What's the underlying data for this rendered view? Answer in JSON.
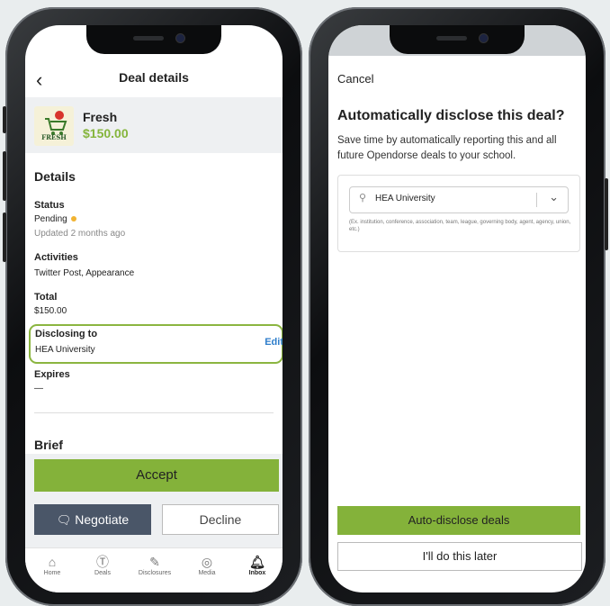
{
  "left": {
    "header": {
      "title": "Deal details",
      "back_icon": "chevron-left-icon"
    },
    "brand": {
      "name": "Fresh",
      "price": "$150.00",
      "logo_text": "FRESH"
    },
    "details": {
      "title": "Details",
      "status_label": "Status",
      "status_value": "Pending",
      "status_updated": "Updated 2 months ago",
      "activities_label": "Activities",
      "activities_value": "Twitter Post, Appearance",
      "total_label": "Total",
      "total_value": "$150.00",
      "disclosing_label": "Disclosing to",
      "disclosing_value": "HEA University",
      "edit_label": "Edit",
      "expires_label": "Expires",
      "expires_value": "—"
    },
    "brief": {
      "title": "Brief"
    },
    "actions": {
      "accept": "Accept",
      "negotiate": "Negotiate",
      "decline": "Decline"
    },
    "tabs": [
      {
        "label": "Home",
        "icon": "home-icon"
      },
      {
        "label": "Deals",
        "icon": "deals-icon"
      },
      {
        "label": "Disclosures",
        "icon": "disclosures-icon"
      },
      {
        "label": "Media",
        "icon": "media-icon"
      },
      {
        "label": "Inbox",
        "icon": "bell-icon"
      }
    ],
    "colors": {
      "accent": "#84b23a",
      "link": "#2f7ecb",
      "pending": "#f1b331",
      "negotiate": "#4a5668"
    }
  },
  "right": {
    "cancel": "Cancel",
    "title": "Automatically disclose this deal?",
    "description": "Save time by automatically reporting this and all future Opendorse deals to  your school.",
    "select": {
      "value": "HEA University"
    },
    "hint": "(Ex. institution, conference, association, team, league, governing body, agent, agency, union, etc.)",
    "primary_button": "Auto-disclose deals",
    "secondary_button": "I'll do this later"
  }
}
